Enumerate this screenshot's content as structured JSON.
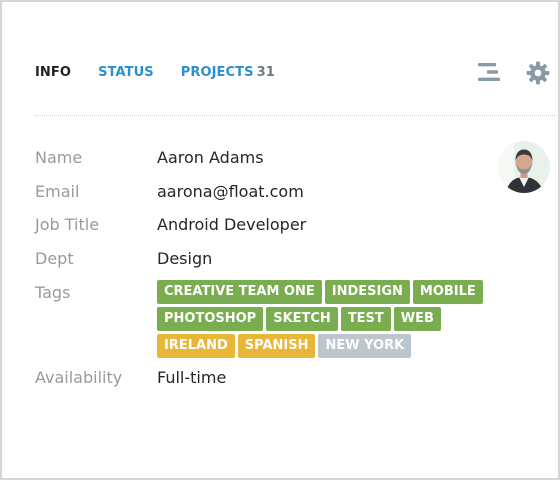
{
  "tabs": [
    {
      "label": "INFO",
      "active": true
    },
    {
      "label": "STATUS",
      "active": false
    },
    {
      "label": "PROJECTS",
      "count": "31",
      "active": false
    }
  ],
  "toolbar": {
    "list_icon": "list-lines-icon",
    "settings_icon": "gear-icon"
  },
  "profile": {
    "fields": {
      "name": {
        "label": "Name",
        "value": "Aaron Adams"
      },
      "email": {
        "label": "Email",
        "value": "aarona@float.com"
      },
      "job_title": {
        "label": "Job Title",
        "value": "Android Developer"
      },
      "dept": {
        "label": "Dept",
        "value": "Design"
      },
      "tags_label": "Tags",
      "availability": {
        "label": "Availability",
        "value": "Full-time"
      }
    },
    "tags": [
      {
        "text": "CREATIVE TEAM ONE",
        "color": "green"
      },
      {
        "text": "INDESIGN",
        "color": "green"
      },
      {
        "text": "MOBILE",
        "color": "green"
      },
      {
        "text": "PHOTOSHOP",
        "color": "green"
      },
      {
        "text": "SKETCH",
        "color": "green"
      },
      {
        "text": "TEST",
        "color": "green"
      },
      {
        "text": "WEB",
        "color": "green"
      },
      {
        "text": "IRELAND",
        "color": "yellow"
      },
      {
        "text": "SPANISH",
        "color": "yellow"
      },
      {
        "text": "NEW YORK",
        "color": "grey"
      }
    ]
  },
  "colors": {
    "accent": "#2b8fd0",
    "tag_green": "#79ad4f",
    "tag_yellow": "#e8b73a",
    "tag_grey": "#bcc6cc"
  }
}
